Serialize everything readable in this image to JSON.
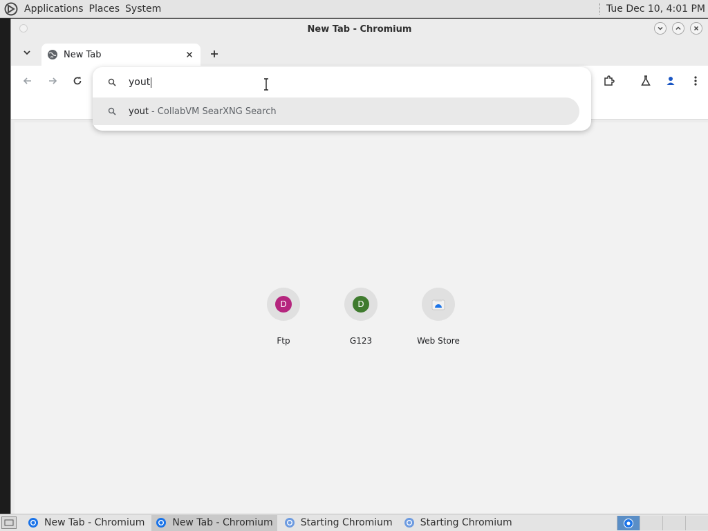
{
  "top_panel": {
    "menus": [
      "Applications",
      "Places",
      "System"
    ],
    "clock": "Tue Dec 10,  4:01 PM"
  },
  "window": {
    "title": "New Tab - Chromium"
  },
  "tab": {
    "title": "New Tab"
  },
  "omnibox": {
    "input": "yout",
    "suggestion_query": "yout",
    "suggestion_desc": "- CollabVM SearXNG Search"
  },
  "shortcuts": [
    {
      "label": "Ftp",
      "letter": "D",
      "color": "#b5267e"
    },
    {
      "label": "G123",
      "letter": "D",
      "color": "#3f7b2e"
    },
    {
      "label": "Web Store",
      "letter": "",
      "color": "#1a73e8"
    }
  ],
  "taskbar": {
    "tasks": [
      "New Tab - Chromium",
      "New Tab - Chromium",
      "Starting Chromium",
      "Starting Chromium"
    ]
  }
}
